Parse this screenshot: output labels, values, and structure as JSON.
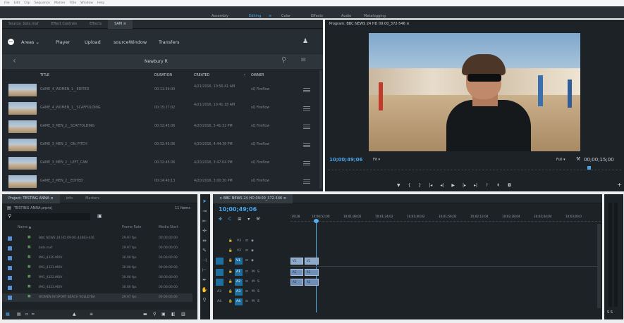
{
  "app_menu": [
    "File",
    "Edit",
    "Clip",
    "Sequence",
    "Marker",
    "Title",
    "Window",
    "Help"
  ],
  "workspaces": [
    {
      "label": "Assembly",
      "active": false
    },
    {
      "label": "Editing",
      "active": true
    },
    {
      "label": "Color",
      "active": false
    },
    {
      "label": "Effects",
      "active": false
    },
    {
      "label": "Audio",
      "active": false
    },
    {
      "label": "Metalogging",
      "active": false
    }
  ],
  "source_tabs": [
    "Source: bots.mxf",
    "Effect Controls",
    "Effects",
    "SAM"
  ],
  "sam": {
    "logo": "sam",
    "nav": [
      "Areas",
      "Player",
      "Upload",
      "sourceWindow",
      "Transfers"
    ],
    "area_title": "Newbury R",
    "columns": {
      "title": "TITLE",
      "duration": "DURATION",
      "created": "CREATED",
      "owner": "OWNER"
    },
    "rows": [
      {
        "title": "GAME_4_WOMEN_1__EDITED",
        "duration": "00:11:39:00",
        "created": "4/21/2016, 10:56:41 AM",
        "owner": "sQ Fireflow"
      },
      {
        "title": "GAME_4_WOMEN_1__SCAFFOLDING",
        "duration": "00:15:27:02",
        "created": "4/21/2016, 10:41:18 AM",
        "owner": "sQ Fireflow"
      },
      {
        "title": "GAME_3_MEN_2__SCAFFOLDING",
        "duration": "00:32:45:06",
        "created": "4/20/2016, 5:41:32 PM",
        "owner": "sQ Fireflow"
      },
      {
        "title": "GAME_3_MEN_2__ON_PITCH",
        "duration": "00:32:45:06",
        "created": "4/20/2016, 4:44:38 PM",
        "owner": "sQ Fireflow"
      },
      {
        "title": "GAME_3_MEN_2__LEFT_CAM",
        "duration": "00:32:45:06",
        "created": "4/20/2016, 3:47:04 PM",
        "owner": "sQ Fireflow"
      },
      {
        "title": "GAME_3_MEN_2__EDITED",
        "duration": "00:14:40:13",
        "created": "4/20/2016, 3:00:30 PM",
        "owner": "sQ Fireflow"
      }
    ]
  },
  "program": {
    "title": "Program: BBC NEWS 24 HD 09:00_372-546",
    "timecode": "10;00;49;06",
    "fit": "Fit",
    "quality": "Full",
    "end_timecode": "00;00;15;00"
  },
  "project": {
    "tabs": [
      "Project: TESTING ANNA",
      "Info",
      "Markers"
    ],
    "file": "TESTING ANNA.prproj",
    "item_count": "11 Items",
    "columns": [
      "Name",
      "Frame Rate",
      "Media Start"
    ],
    "items": [
      {
        "name": "BBC NEWS 24 HD 09:00_43683-436",
        "rate": "29.97 fps",
        "start": "00:00:00:00"
      },
      {
        "name": "bots.mxf",
        "rate": "29.97 fps",
        "start": "00:00:00:00"
      },
      {
        "name": "IMG_4320.MOV",
        "rate": "30.00 fps",
        "start": "00:00:00:00"
      },
      {
        "name": "IMG_4321.MOV",
        "rate": "30.00 fps",
        "start": "00:00:00:00"
      },
      {
        "name": "IMG_4322.MOV",
        "rate": "30.00 fps",
        "start": "00:00:00:00"
      },
      {
        "name": "IMG_4323.MOV",
        "rate": "30.00 fps",
        "start": "00:00:00:00"
      },
      {
        "name": "WOMEN IN SPORT BEACH VOLLEYBA",
        "rate": "29.97 fps",
        "start": "00:00:00:00"
      }
    ]
  },
  "timeline": {
    "tab": "BBC NEWS 24 HD 09:00_372-546",
    "timecode": "10;00;49;06",
    "ruler": [
      ":29;28",
      "10;00;52;00",
      "10;01;08;02",
      "10;01;24;02",
      "10;01;40;02",
      "10;01;56;02",
      "10;02;12;04",
      "10;02;28;04",
      "10;02;44;04",
      "10;03;00;0"
    ],
    "video_tracks": [
      "V3",
      "V2",
      "V1"
    ],
    "audio_tracks": [
      "A1",
      "A2",
      "A3",
      "A4"
    ],
    "clip_labels": [
      "V1",
      "V1",
      "A1",
      "A1",
      "A2",
      "A2"
    ],
    "audio_flags": [
      "M",
      "S"
    ]
  },
  "colors": {
    "accent": "#3b8fd9",
    "panel": "#1d2226",
    "playhead": "#55b0e8"
  }
}
